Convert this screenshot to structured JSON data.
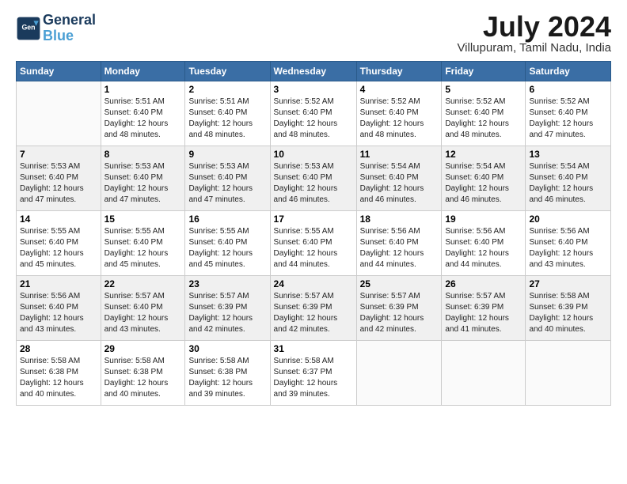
{
  "header": {
    "logo_line1": "General",
    "logo_line2": "Blue",
    "month_title": "July 2024",
    "location": "Villupuram, Tamil Nadu, India"
  },
  "days_of_week": [
    "Sunday",
    "Monday",
    "Tuesday",
    "Wednesday",
    "Thursday",
    "Friday",
    "Saturday"
  ],
  "weeks": [
    [
      {
        "day": "",
        "info": ""
      },
      {
        "day": "1",
        "info": "Sunrise: 5:51 AM\nSunset: 6:40 PM\nDaylight: 12 hours\nand 48 minutes."
      },
      {
        "day": "2",
        "info": "Sunrise: 5:51 AM\nSunset: 6:40 PM\nDaylight: 12 hours\nand 48 minutes."
      },
      {
        "day": "3",
        "info": "Sunrise: 5:52 AM\nSunset: 6:40 PM\nDaylight: 12 hours\nand 48 minutes."
      },
      {
        "day": "4",
        "info": "Sunrise: 5:52 AM\nSunset: 6:40 PM\nDaylight: 12 hours\nand 48 minutes."
      },
      {
        "day": "5",
        "info": "Sunrise: 5:52 AM\nSunset: 6:40 PM\nDaylight: 12 hours\nand 48 minutes."
      },
      {
        "day": "6",
        "info": "Sunrise: 5:52 AM\nSunset: 6:40 PM\nDaylight: 12 hours\nand 47 minutes."
      }
    ],
    [
      {
        "day": "7",
        "info": "Sunrise: 5:53 AM\nSunset: 6:40 PM\nDaylight: 12 hours\nand 47 minutes."
      },
      {
        "day": "8",
        "info": "Sunrise: 5:53 AM\nSunset: 6:40 PM\nDaylight: 12 hours\nand 47 minutes."
      },
      {
        "day": "9",
        "info": "Sunrise: 5:53 AM\nSunset: 6:40 PM\nDaylight: 12 hours\nand 47 minutes."
      },
      {
        "day": "10",
        "info": "Sunrise: 5:53 AM\nSunset: 6:40 PM\nDaylight: 12 hours\nand 46 minutes."
      },
      {
        "day": "11",
        "info": "Sunrise: 5:54 AM\nSunset: 6:40 PM\nDaylight: 12 hours\nand 46 minutes."
      },
      {
        "day": "12",
        "info": "Sunrise: 5:54 AM\nSunset: 6:40 PM\nDaylight: 12 hours\nand 46 minutes."
      },
      {
        "day": "13",
        "info": "Sunrise: 5:54 AM\nSunset: 6:40 PM\nDaylight: 12 hours\nand 46 minutes."
      }
    ],
    [
      {
        "day": "14",
        "info": "Sunrise: 5:55 AM\nSunset: 6:40 PM\nDaylight: 12 hours\nand 45 minutes."
      },
      {
        "day": "15",
        "info": "Sunrise: 5:55 AM\nSunset: 6:40 PM\nDaylight: 12 hours\nand 45 minutes."
      },
      {
        "day": "16",
        "info": "Sunrise: 5:55 AM\nSunset: 6:40 PM\nDaylight: 12 hours\nand 45 minutes."
      },
      {
        "day": "17",
        "info": "Sunrise: 5:55 AM\nSunset: 6:40 PM\nDaylight: 12 hours\nand 44 minutes."
      },
      {
        "day": "18",
        "info": "Sunrise: 5:56 AM\nSunset: 6:40 PM\nDaylight: 12 hours\nand 44 minutes."
      },
      {
        "day": "19",
        "info": "Sunrise: 5:56 AM\nSunset: 6:40 PM\nDaylight: 12 hours\nand 44 minutes."
      },
      {
        "day": "20",
        "info": "Sunrise: 5:56 AM\nSunset: 6:40 PM\nDaylight: 12 hours\nand 43 minutes."
      }
    ],
    [
      {
        "day": "21",
        "info": "Sunrise: 5:56 AM\nSunset: 6:40 PM\nDaylight: 12 hours\nand 43 minutes."
      },
      {
        "day": "22",
        "info": "Sunrise: 5:57 AM\nSunset: 6:40 PM\nDaylight: 12 hours\nand 43 minutes."
      },
      {
        "day": "23",
        "info": "Sunrise: 5:57 AM\nSunset: 6:39 PM\nDaylight: 12 hours\nand 42 minutes."
      },
      {
        "day": "24",
        "info": "Sunrise: 5:57 AM\nSunset: 6:39 PM\nDaylight: 12 hours\nand 42 minutes."
      },
      {
        "day": "25",
        "info": "Sunrise: 5:57 AM\nSunset: 6:39 PM\nDaylight: 12 hours\nand 42 minutes."
      },
      {
        "day": "26",
        "info": "Sunrise: 5:57 AM\nSunset: 6:39 PM\nDaylight: 12 hours\nand 41 minutes."
      },
      {
        "day": "27",
        "info": "Sunrise: 5:58 AM\nSunset: 6:39 PM\nDaylight: 12 hours\nand 40 minutes."
      }
    ],
    [
      {
        "day": "28",
        "info": "Sunrise: 5:58 AM\nSunset: 6:38 PM\nDaylight: 12 hours\nand 40 minutes."
      },
      {
        "day": "29",
        "info": "Sunrise: 5:58 AM\nSunset: 6:38 PM\nDaylight: 12 hours\nand 40 minutes."
      },
      {
        "day": "30",
        "info": "Sunrise: 5:58 AM\nSunset: 6:38 PM\nDaylight: 12 hours\nand 39 minutes."
      },
      {
        "day": "31",
        "info": "Sunrise: 5:58 AM\nSunset: 6:37 PM\nDaylight: 12 hours\nand 39 minutes."
      },
      {
        "day": "",
        "info": ""
      },
      {
        "day": "",
        "info": ""
      },
      {
        "day": "",
        "info": ""
      }
    ]
  ]
}
